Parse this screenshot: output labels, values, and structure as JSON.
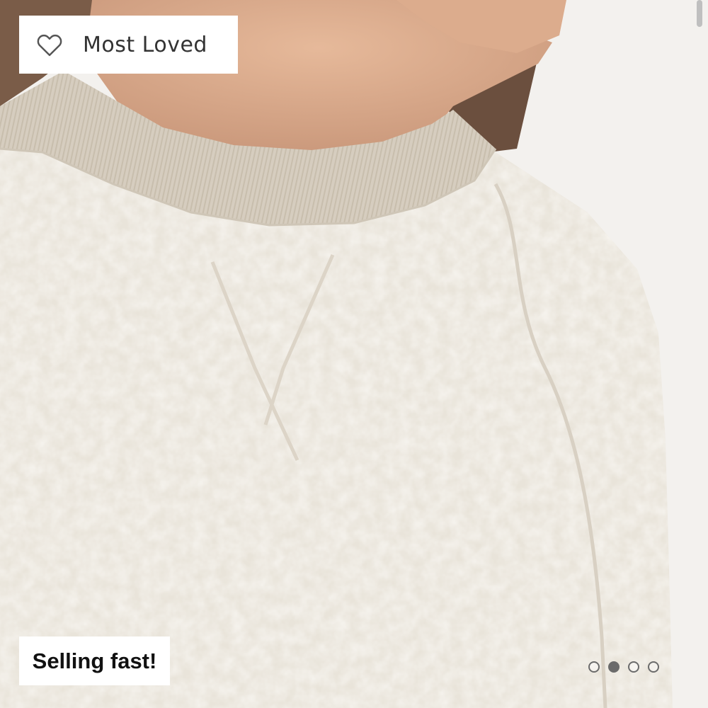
{
  "badges": {
    "most_loved": {
      "label": "Most Loved",
      "icon": "heart-outline-icon"
    },
    "selling_fast": {
      "label": "Selling fast!"
    }
  },
  "carousel": {
    "total_slides": 4,
    "active_index": 1
  },
  "photo": {
    "subject": "cream sherpa fleece crew sweatshirt",
    "fabric_color": "#e9e4da",
    "rib_color": "#d4cbbd",
    "skin_color": "#d9ab8c",
    "hair_color": "#6f5544",
    "background_color": "#f3f1ee"
  }
}
